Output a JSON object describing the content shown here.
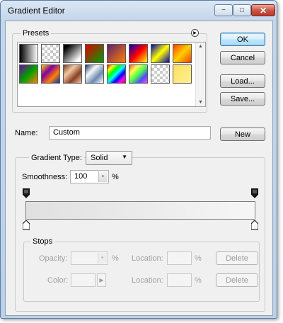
{
  "window": {
    "title": "Gradient Editor",
    "min_glyph": "−",
    "max_glyph": "□",
    "close_glyph": "✕"
  },
  "presets": {
    "label": "Presets",
    "menu_glyph": "▶",
    "scroll_up_glyph": "▲",
    "scroll_down_glyph": "▼",
    "swatches": [
      {
        "name": "foreground-to-background",
        "fill": "linear-gradient(to right, #000, #fff)"
      },
      {
        "name": "foreground-to-transparent",
        "fill": "checker"
      },
      {
        "name": "black-white",
        "fill": "linear-gradient(135deg, #000 15%, #fff 85%)"
      },
      {
        "name": "red-green",
        "fill": "linear-gradient(135deg, #e00000, #00a000)"
      },
      {
        "name": "violet-orange",
        "fill": "linear-gradient(135deg, #602070, #ff8000)"
      },
      {
        "name": "blue-red-yellow",
        "fill": "linear-gradient(135deg, #0000c0, #ff0000, #ffff00)"
      },
      {
        "name": "blue-yellow-blue",
        "fill": "linear-gradient(135deg, #0000b0, #ffff00, #0000b0)"
      },
      {
        "name": "orange-yellow-orange",
        "fill": "linear-gradient(135deg, #ff4000, #ffd000, #ff4000)"
      },
      {
        "name": "violet-green-orange",
        "fill": "linear-gradient(135deg, #7000a0, #00a000, #ff8000)"
      },
      {
        "name": "yellow-violet-orange-blue",
        "fill": "linear-gradient(135deg, #ffd000, #8000a0, #ff8000, #0030c0)"
      },
      {
        "name": "copper",
        "fill": "linear-gradient(135deg, #7a3a1a, #f0c8a8, #8a4020, #f0c8a8)"
      },
      {
        "name": "chrome",
        "fill": "linear-gradient(135deg, #1a3a6a, #f8f8f8, #6a8ab0, #fff)"
      },
      {
        "name": "spectrum",
        "fill": "linear-gradient(135deg, #ff0000, #ffff00, #00ff00, #00ffff, #0000ff, #ff00ff, #ff0000)"
      },
      {
        "name": "transparent-rainbow",
        "fill": "linear-gradient(135deg, rgba(255,0,0,.7), rgba(255,255,0,.7), rgba(0,255,0,.7), rgba(0,0,255,.7), rgba(255,0,255,.7))"
      },
      {
        "name": "transparent-stripes",
        "fill": "checker"
      },
      {
        "name": "yellow-gold",
        "fill": "linear-gradient(135deg, #ffe060, #fff090)"
      }
    ]
  },
  "buttons": {
    "ok": "OK",
    "cancel": "Cancel",
    "load": "Load...",
    "save": "Save...",
    "new": "New"
  },
  "name": {
    "label": "Name:",
    "value": "Custom"
  },
  "gradient": {
    "group_label": "Gradient Type:",
    "type_value": "Solid",
    "type_caret": "▼",
    "smoothness_label": "Smoothness:",
    "smoothness_value": "100",
    "smoothness_stepper": "▸",
    "smoothness_unit": "%"
  },
  "stops": {
    "label": "Stops",
    "opacity_label": "Opacity:",
    "opacity_unit": "%",
    "opacity_stepper": "▸",
    "location_label": "Location:",
    "location_unit": "%",
    "delete_label": "Delete",
    "color_label": "Color:",
    "color_arrow": "▶"
  },
  "colors": {
    "accent": "#3c7fb1",
    "gradient_start": "#e0e0e0",
    "gradient_end": "#f6f6f6"
  }
}
